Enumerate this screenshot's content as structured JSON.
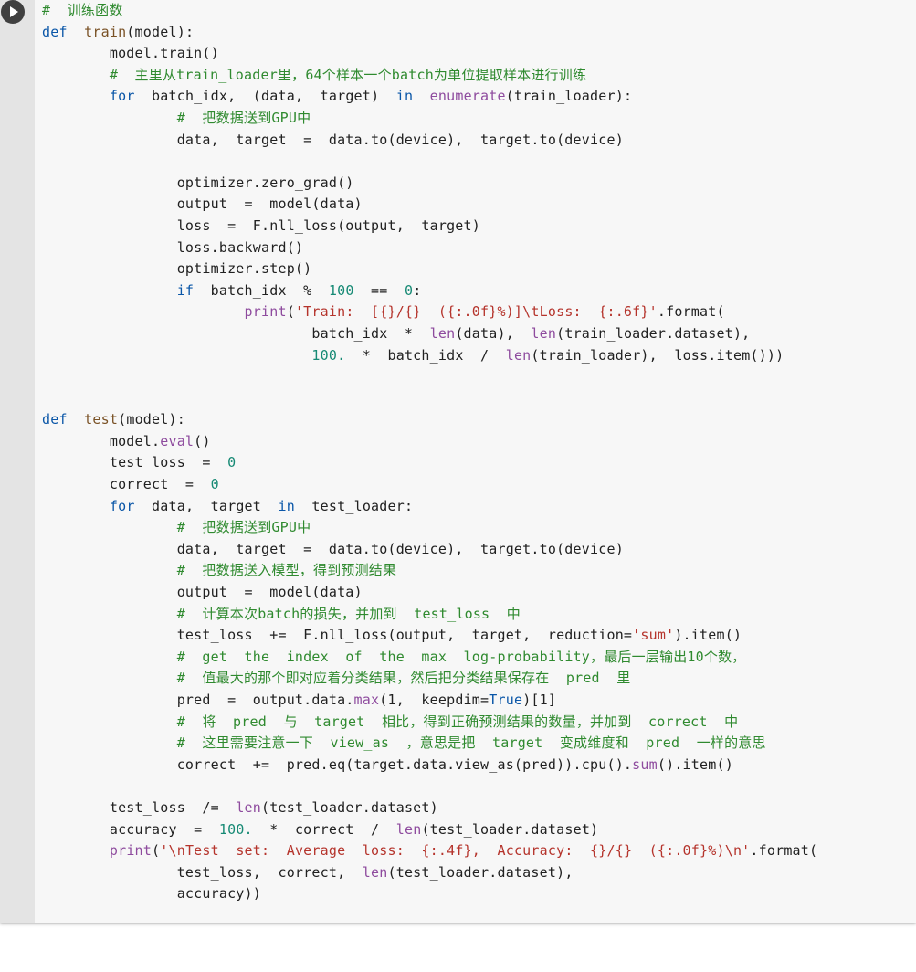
{
  "cell": {
    "run_button": "run-cell",
    "lines": [
      [
        [
          "cm",
          "#  训练函数"
        ]
      ],
      [
        [
          "kw",
          "def"
        ],
        [
          "op",
          "  "
        ],
        [
          "fn",
          "train"
        ],
        [
          "op",
          "(model):"
        ]
      ],
      [
        [
          "op",
          "        model.train()"
        ]
      ],
      [
        [
          "op",
          "        "
        ],
        [
          "cm",
          "#  主里从train_loader里，64个样本一个batch为单位提取样本进行训练"
        ]
      ],
      [
        [
          "op",
          "        "
        ],
        [
          "kw",
          "for"
        ],
        [
          "op",
          "  batch_idx,  (data,  target)  "
        ],
        [
          "kw",
          "in"
        ],
        [
          "op",
          "  "
        ],
        [
          "bi",
          "enumerate"
        ],
        [
          "op",
          "(train_loader):"
        ]
      ],
      [
        [
          "op",
          "                "
        ],
        [
          "cm",
          "#  把数据送到GPU中"
        ]
      ],
      [
        [
          "op",
          "                data,  target  =  data.to(device),  target.to(device)"
        ]
      ],
      [
        [
          "op",
          ""
        ]
      ],
      [
        [
          "op",
          "                optimizer.zero_grad()"
        ]
      ],
      [
        [
          "op",
          "                output  =  model(data)"
        ]
      ],
      [
        [
          "op",
          "                loss  =  F.nll_loss(output,  target)"
        ]
      ],
      [
        [
          "op",
          "                loss.backward()"
        ]
      ],
      [
        [
          "op",
          "                optimizer.step()"
        ]
      ],
      [
        [
          "op",
          "                "
        ],
        [
          "kw",
          "if"
        ],
        [
          "op",
          "  batch_idx  %  "
        ],
        [
          "num",
          "100"
        ],
        [
          "op",
          "  ==  "
        ],
        [
          "num",
          "0"
        ],
        [
          "op",
          ":"
        ]
      ],
      [
        [
          "op",
          "                        "
        ],
        [
          "bi",
          "print"
        ],
        [
          "op",
          "("
        ],
        [
          "str",
          "'Train:  [{}/{}  ({:.0f}%)]\\tLoss:  {:.6f}'"
        ],
        [
          "op",
          ".format("
        ]
      ],
      [
        [
          "op",
          "                                batch_idx  *  "
        ],
        [
          "bi",
          "len"
        ],
        [
          "op",
          "(data),  "
        ],
        [
          "bi",
          "len"
        ],
        [
          "op",
          "(train_loader.dataset),"
        ]
      ],
      [
        [
          "op",
          "                                "
        ],
        [
          "num",
          "100."
        ],
        [
          "op",
          "  *  batch_idx  /  "
        ],
        [
          "bi",
          "len"
        ],
        [
          "op",
          "(train_loader),  loss.item()))"
        ]
      ],
      [
        [
          "op",
          ""
        ]
      ],
      [
        [
          "op",
          ""
        ]
      ],
      [
        [
          "kw",
          "def"
        ],
        [
          "op",
          "  "
        ],
        [
          "fn",
          "test"
        ],
        [
          "op",
          "(model):"
        ]
      ],
      [
        [
          "op",
          "        model."
        ],
        [
          "bi",
          "eval"
        ],
        [
          "op",
          "()"
        ]
      ],
      [
        [
          "op",
          "        test_loss  =  "
        ],
        [
          "num",
          "0"
        ]
      ],
      [
        [
          "op",
          "        correct  =  "
        ],
        [
          "num",
          "0"
        ]
      ],
      [
        [
          "op",
          "        "
        ],
        [
          "kw",
          "for"
        ],
        [
          "op",
          "  data,  target  "
        ],
        [
          "kw",
          "in"
        ],
        [
          "op",
          "  test_loader:"
        ]
      ],
      [
        [
          "op",
          "                "
        ],
        [
          "cm",
          "#  把数据送到GPU中"
        ]
      ],
      [
        [
          "op",
          "                data,  target  =  data.to(device),  target.to(device)"
        ]
      ],
      [
        [
          "op",
          "                "
        ],
        [
          "cm",
          "#  把数据送入模型，得到预测结果"
        ]
      ],
      [
        [
          "op",
          "                output  =  model(data)"
        ]
      ],
      [
        [
          "op",
          "                "
        ],
        [
          "cm",
          "#  计算本次batch的损失，并加到  test_loss  中"
        ]
      ],
      [
        [
          "op",
          "                test_loss  +=  F.nll_loss(output,  target,  reduction="
        ],
        [
          "str",
          "'sum'"
        ],
        [
          "op",
          ").item()"
        ]
      ],
      [
        [
          "op",
          "                "
        ],
        [
          "cm",
          "#  get  the  index  of  the  max  log-probability，最后一层输出10个数，"
        ]
      ],
      [
        [
          "op",
          "                "
        ],
        [
          "cm",
          "#  值最大的那个即对应着分类结果，然后把分类结果保存在  pred  里"
        ]
      ],
      [
        [
          "op",
          "                pred  =  output.data."
        ],
        [
          "bi",
          "max"
        ],
        [
          "op",
          "(1,  keepdim="
        ],
        [
          "kw",
          "True"
        ],
        [
          "op",
          ")[1]"
        ]
      ],
      [
        [
          "op",
          "                "
        ],
        [
          "cm",
          "#  将  pred  与  target  相比，得到正确预测结果的数量，并加到  correct  中"
        ]
      ],
      [
        [
          "op",
          "                "
        ],
        [
          "cm",
          "#  这里需要注意一下  view_as  ，意思是把  target  变成维度和  pred  一样的意思"
        ]
      ],
      [
        [
          "op",
          "                correct  +=  pred.eq(target.data.view_as(pred)).cpu()."
        ],
        [
          "bi",
          "sum"
        ],
        [
          "op",
          "().item()"
        ]
      ],
      [
        [
          "op",
          ""
        ]
      ],
      [
        [
          "op",
          "        test_loss  /=  "
        ],
        [
          "bi",
          "len"
        ],
        [
          "op",
          "(test_loader.dataset)"
        ]
      ],
      [
        [
          "op",
          "        accuracy  =  "
        ],
        [
          "num",
          "100."
        ],
        [
          "op",
          "  *  correct  /  "
        ],
        [
          "bi",
          "len"
        ],
        [
          "op",
          "(test_loader.dataset)"
        ]
      ],
      [
        [
          "op",
          "        "
        ],
        [
          "bi",
          "print"
        ],
        [
          "op",
          "("
        ],
        [
          "str",
          "'\\nTest  set:  Average  loss:  {:.4f},  Accuracy:  {}/{}  ({:.0f}%)\\n'"
        ],
        [
          "op",
          ".format("
        ]
      ],
      [
        [
          "op",
          "                test_loss,  correct,  "
        ],
        [
          "bi",
          "len"
        ],
        [
          "op",
          "(test_loader.dataset),"
        ]
      ],
      [
        [
          "op",
          "                accuracy))"
        ]
      ]
    ]
  }
}
